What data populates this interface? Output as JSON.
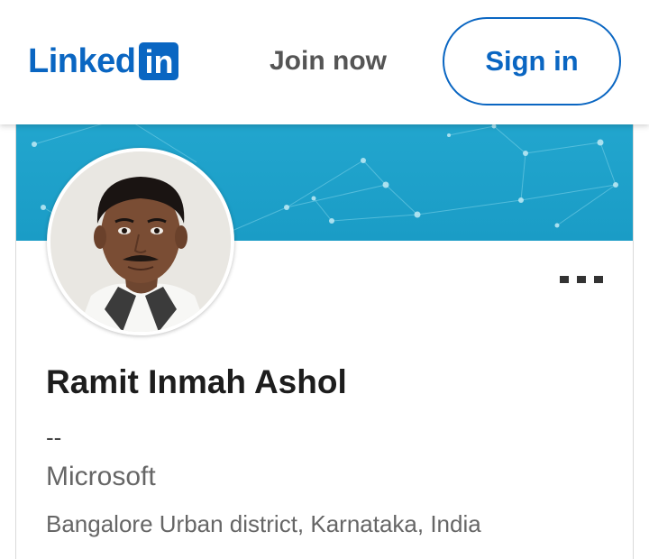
{
  "header": {
    "logo_text": "Linked",
    "logo_box": "in",
    "join_label": "Join now",
    "signin_label": "Sign in"
  },
  "profile": {
    "name": "Ramit Inmah Ashol",
    "headline": "--",
    "company": "Microsoft",
    "location": "Bangalore Urban district, Karnataka, India"
  },
  "icons": {
    "more": "more-horizontal-icon"
  },
  "colors": {
    "brand": "#0a66c2",
    "banner": "#1fa3cc"
  }
}
